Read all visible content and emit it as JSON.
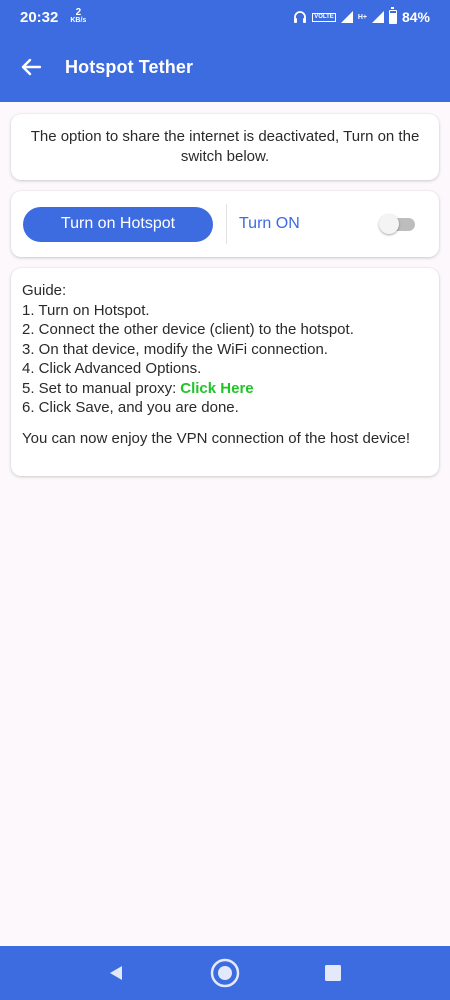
{
  "status": {
    "time": "20:32",
    "net_speed_value": "2",
    "net_speed_unit": "KB/s",
    "volte": "VOLTE",
    "data_type": "H+",
    "battery": "84%"
  },
  "appbar": {
    "title": "Hotspot Tether",
    "back_icon": "arrow-left-icon"
  },
  "notice": {
    "text": "The option to share the internet is deactivated, Turn on the switch below."
  },
  "toggle_card": {
    "button_label": "Turn on Hotspot",
    "switch_label": "Turn ON",
    "switch_on": false
  },
  "guide": {
    "heading": "Guide:",
    "step1": "1. Turn on Hotspot.",
    "step2": "2. Connect the other device (client) to the hotspot.",
    "step3": "3. On that device, modify the WiFi connection.",
    "step4": "4. Click Advanced Options.",
    "step5_prefix": "5. Set to manual proxy:",
    "step5_link": "Click Here",
    "step6": "6. Click Save, and you are done.",
    "footer": "You can now enjoy the VPN connection of the host device!"
  },
  "colors": {
    "accent": "#3d6be0",
    "link": "#22c32a",
    "background": "#fcf8fc"
  }
}
